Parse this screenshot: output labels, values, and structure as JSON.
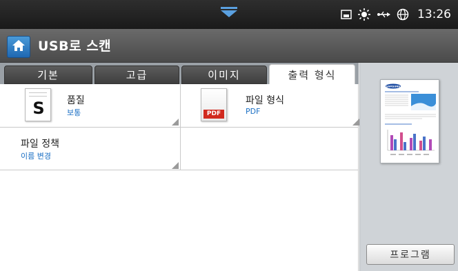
{
  "status_bar": {
    "time": "13:26",
    "icons": [
      "pull-down-icon",
      "memory-card-icon",
      "toner-status-icon",
      "usb-icon",
      "network-globe-icon"
    ]
  },
  "header": {
    "title": "USB로 스캔",
    "home_icon": "home-icon"
  },
  "tabs": [
    {
      "label": "기본",
      "active": false
    },
    {
      "label": "고급",
      "active": false
    },
    {
      "label": "이미지",
      "active": false
    },
    {
      "label": "출력 형식",
      "active": true
    }
  ],
  "options": {
    "quality": {
      "label": "품질",
      "value": "보통",
      "icon_letter": "S"
    },
    "file_format": {
      "label": "파일 형식",
      "value": "PDF",
      "icon_badge": "PDF"
    },
    "file_policy": {
      "label": "파일 정책",
      "value": "이름 변경"
    }
  },
  "preview": {
    "brand_text": "SAMSUNG",
    "program_label": "프로그램"
  },
  "colors": {
    "accent_blue": "#1a6fc4",
    "pdf_red": "#d12a1f",
    "home_blue": "#2f7fc6"
  }
}
